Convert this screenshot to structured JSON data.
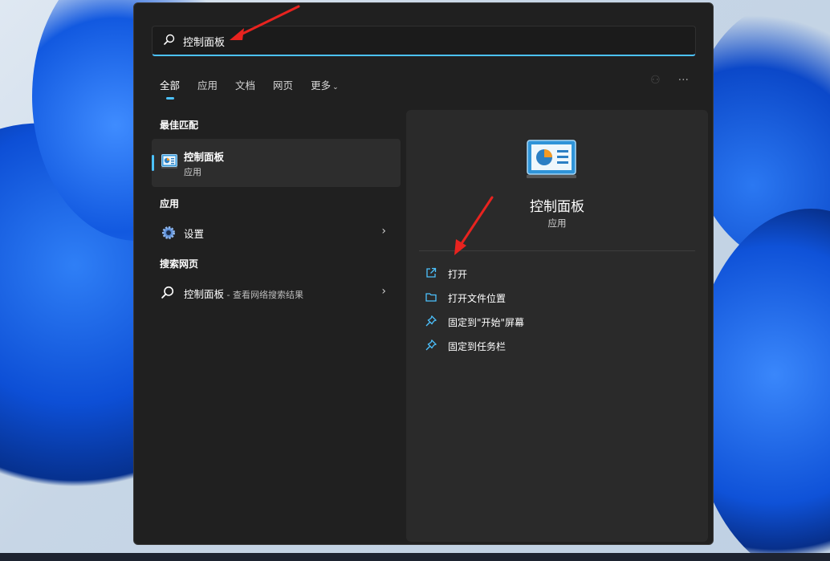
{
  "search": {
    "icon": "search-icon",
    "value": "控制面板"
  },
  "tabs": [
    {
      "label": "全部",
      "active": true
    },
    {
      "label": "应用"
    },
    {
      "label": "文档"
    },
    {
      "label": "网页"
    },
    {
      "label": "更多"
    }
  ],
  "sections": {
    "best_match": "最佳匹配",
    "apps": "应用",
    "web": "搜索网页"
  },
  "best_match": {
    "title": "控制面板",
    "subtitle": "应用",
    "icon": "control-panel-icon"
  },
  "apps_list": [
    {
      "label": "设置",
      "icon": "settings-gear-icon"
    }
  ],
  "web_list": [
    {
      "query": "控制面板",
      "suffix": " - 查看网络搜索结果",
      "icon": "search-icon"
    }
  ],
  "detail": {
    "name": "控制面板",
    "type": "应用",
    "actions": [
      {
        "label": "打开",
        "icon": "open-external-icon"
      },
      {
        "label": "打开文件位置",
        "icon": "folder-icon"
      },
      {
        "label": "固定到\"开始\"屏幕",
        "icon": "pin-icon"
      },
      {
        "label": "固定到任务栏",
        "icon": "pin-icon"
      }
    ]
  },
  "colors": {
    "accent": "#4cc2ff",
    "panel": "#202020",
    "annotation": "#e8231f"
  }
}
